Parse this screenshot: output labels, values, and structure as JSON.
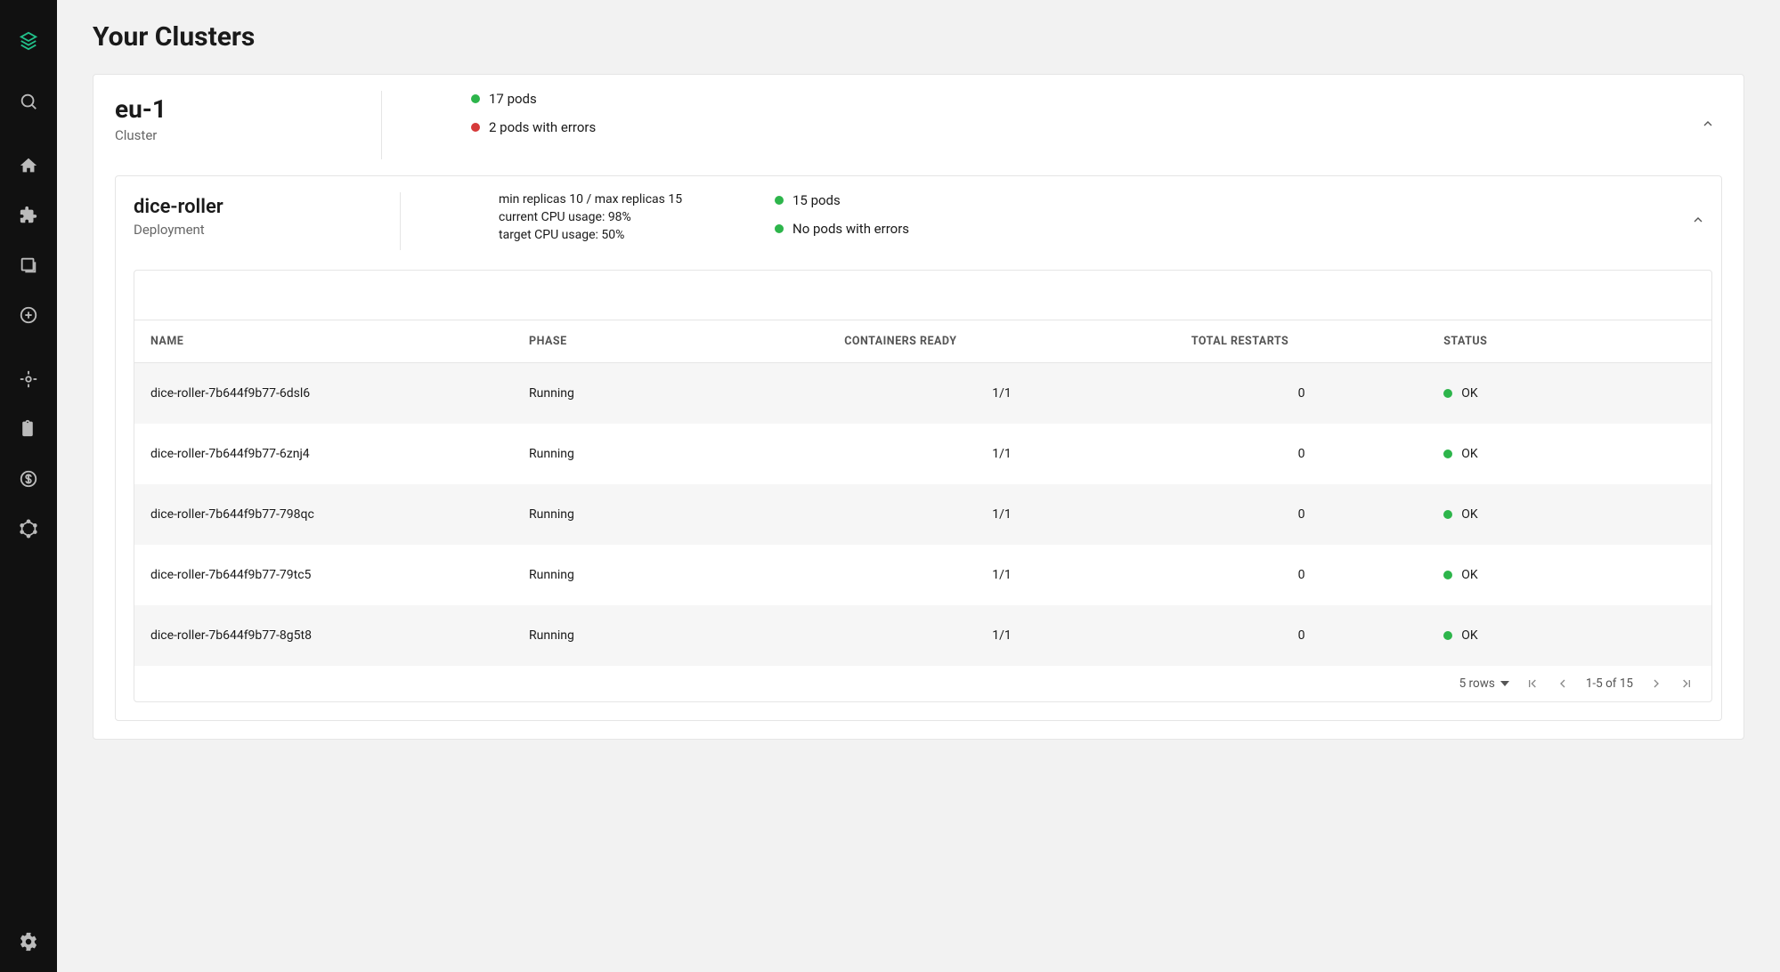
{
  "page": {
    "title": "Your Clusters"
  },
  "colors": {
    "accent": "#22c08a",
    "ok": "#2db54b",
    "error": "#d63a3a"
  },
  "sidebar": {
    "icons": [
      "logo-icon",
      "search-icon",
      "home-icon",
      "extension-icon",
      "library-icon",
      "add-circle-icon",
      "target-icon",
      "clipboard-icon",
      "dollar-icon",
      "graphql-icon",
      "gear-icon"
    ]
  },
  "cluster": {
    "name": "eu-1",
    "type_label": "Cluster",
    "pods_status": "17 pods",
    "pods_error_status": "2 pods with errors"
  },
  "deployment": {
    "name": "dice-roller",
    "type_label": "Deployment",
    "replicas_line": "min replicas 10 / max replicas 15",
    "current_cpu_line": "current CPU usage: 98%",
    "target_cpu_line": "target CPU usage: 50%",
    "pods_status": "15 pods",
    "pods_error_status": "No pods with errors"
  },
  "pods_table": {
    "headers": {
      "name": "NAME",
      "phase": "PHASE",
      "ready": "CONTAINERS READY",
      "restarts": "TOTAL RESTARTS",
      "status": "STATUS"
    },
    "rows": [
      {
        "name": "dice-roller-7b644f9b77-6dsl6",
        "phase": "Running",
        "ready": "1/1",
        "restarts": "0",
        "status": "OK"
      },
      {
        "name": "dice-roller-7b644f9b77-6znj4",
        "phase": "Running",
        "ready": "1/1",
        "restarts": "0",
        "status": "OK"
      },
      {
        "name": "dice-roller-7b644f9b77-798qc",
        "phase": "Running",
        "ready": "1/1",
        "restarts": "0",
        "status": "OK"
      },
      {
        "name": "dice-roller-7b644f9b77-79tc5",
        "phase": "Running",
        "ready": "1/1",
        "restarts": "0",
        "status": "OK"
      },
      {
        "name": "dice-roller-7b644f9b77-8g5t8",
        "phase": "Running",
        "ready": "1/1",
        "restarts": "0",
        "status": "OK"
      }
    ]
  },
  "pagination": {
    "rows_label": "5 rows",
    "range_label": "1-5 of 15"
  }
}
